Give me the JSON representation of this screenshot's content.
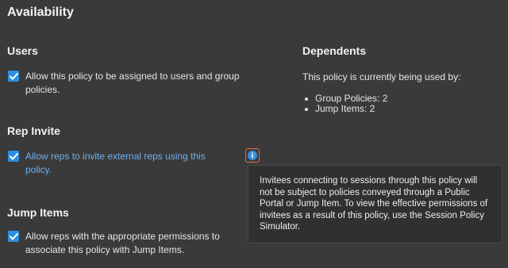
{
  "page": {
    "title": "Availability"
  },
  "users": {
    "heading": "Users",
    "checkbox_label": "Allow this policy to be assigned to users and group policies.",
    "checked": true
  },
  "rep_invite": {
    "heading": "Rep Invite",
    "checkbox_label": "Allow reps to invite external reps using this policy.",
    "checked": true
  },
  "jump_items": {
    "heading": "Jump Items",
    "checkbox_label": "Allow reps with the appropriate permissions to associate this policy with Jump Items.",
    "checked": true
  },
  "dependents": {
    "heading": "Dependents",
    "description": "This policy is currently being used by:",
    "items": [
      "Group Policies: 2",
      "Jump Items: 2"
    ]
  },
  "tooltip": {
    "icon": "info-icon",
    "text": "Invitees connecting to sessions through this policy will not be subject to policies conveyed through a Public Portal or Jump Item. To view the effective permissions of invitees as a result of this policy, use the Session Policy Simulator."
  },
  "colors": {
    "background": "#3a3a3a",
    "checkbox": "#2e8fe0",
    "link": "#6fb0ea",
    "focus_ring": "#d9734a",
    "info_icon": "#3d8fe0",
    "tooltip_bg": "#303030"
  }
}
